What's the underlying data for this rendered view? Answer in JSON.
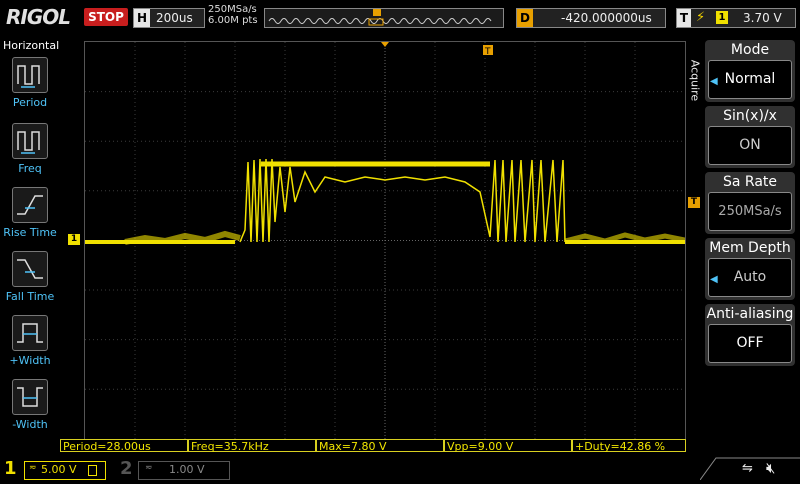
{
  "brand": "RIGOL",
  "run_state": "STOP",
  "horizontal": {
    "key": "H",
    "timebase": "200us",
    "sample_rate": "250MSa/s",
    "points": "6.00M pts"
  },
  "delay": {
    "key": "D",
    "value": "-420.000000us"
  },
  "trigger": {
    "key": "T",
    "source": "1",
    "level": "3.70 V",
    "marker": "T"
  },
  "left_menu": {
    "title": "Horizontal",
    "items": [
      {
        "label": "Period",
        "icon": "period-icon"
      },
      {
        "label": "Freq",
        "icon": "freq-icon"
      },
      {
        "label": "Rise Time",
        "icon": "rise-time-icon"
      },
      {
        "label": "Fall Time",
        "icon": "fall-time-icon"
      },
      {
        "label": "+Width",
        "icon": "pos-width-icon"
      },
      {
        "label": "-Width",
        "icon": "neg-width-icon"
      }
    ]
  },
  "right_menu": {
    "section": "Acquire",
    "items": [
      {
        "label": "Mode",
        "value": "Normal"
      },
      {
        "label": "Sin(x)/x",
        "value": "ON"
      },
      {
        "label": "Sa Rate",
        "value": "250MSa/s"
      },
      {
        "label": "Mem Depth",
        "value": "Auto"
      },
      {
        "label": "Anti-aliasing",
        "value": "OFF"
      }
    ]
  },
  "measurements": [
    {
      "text": "Period=28.00us"
    },
    {
      "text": "Freq=35.7kHz"
    },
    {
      "text": "Max=7.80 V"
    },
    {
      "text": "Vpp=9.00 V"
    },
    {
      "text": "+Duty=42.86 %"
    }
  ],
  "channels": {
    "ch1": {
      "num": "1",
      "coupling": "≂",
      "scale": "5.00 V"
    },
    "ch2": {
      "num": "2",
      "coupling": "≂",
      "scale": "1.00 V"
    }
  },
  "ch1_marker": "1",
  "colors": {
    "ch1": "#f0e000",
    "grid": "#4a4a4a",
    "accent": "#e8a000",
    "stop": "#c81e1e"
  }
}
